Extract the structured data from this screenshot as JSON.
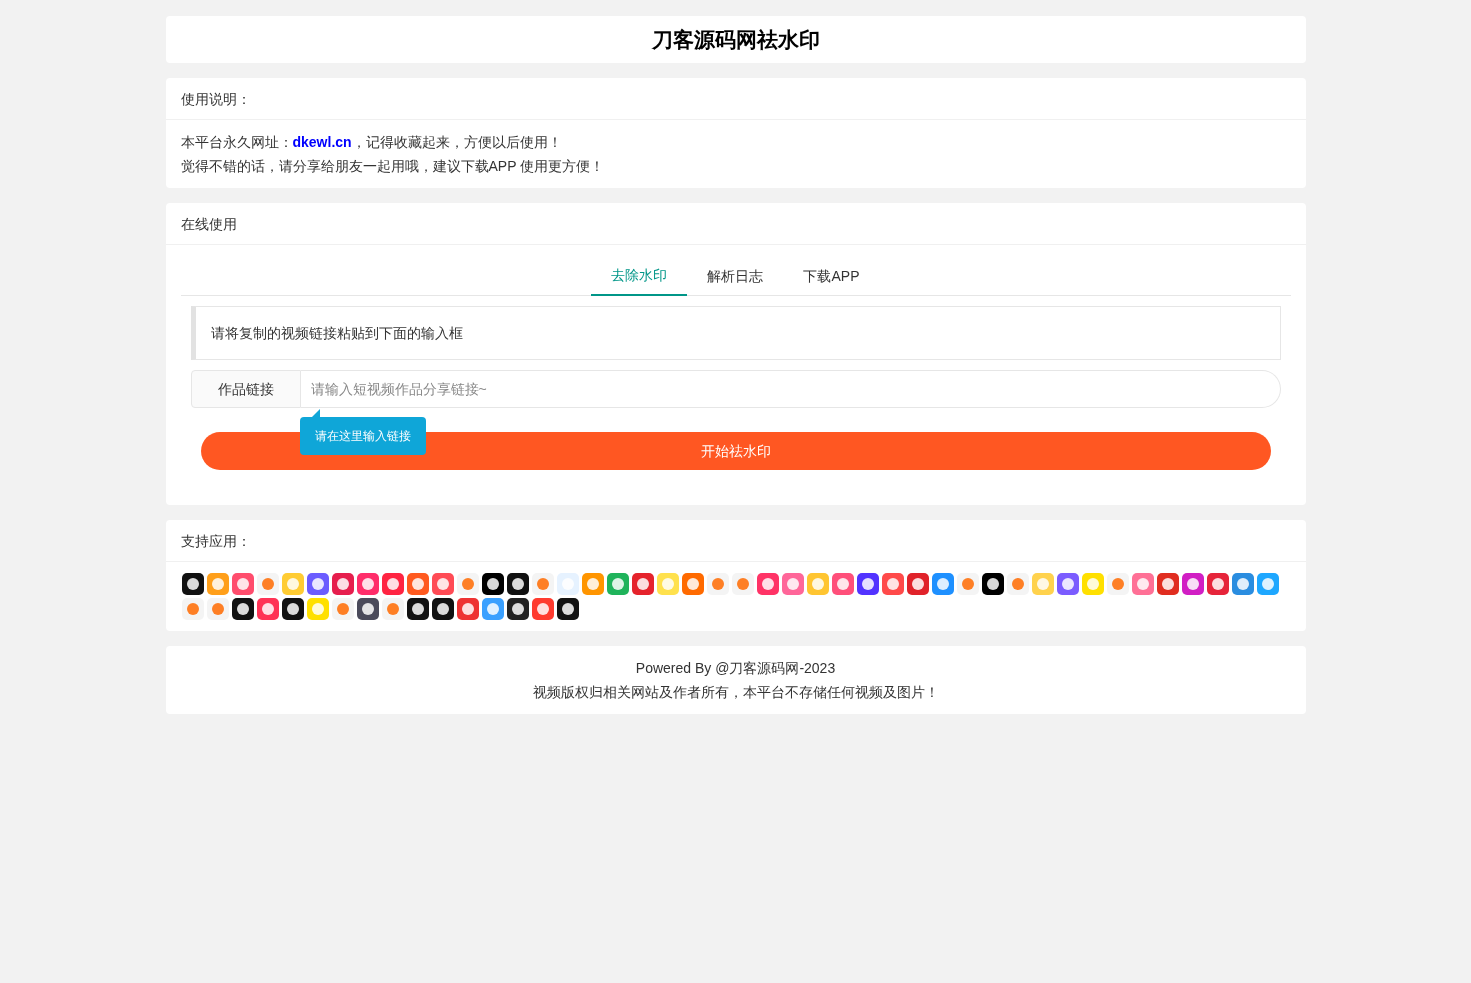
{
  "header": {
    "title": "刀客源码网祛水印"
  },
  "instructions": {
    "heading": "使用说明：",
    "lines": [
      "本平台永久网址：**dkewl.cn**，记得收藏起来，方便以后使用！",
      "觉得不错的话，请分享给朋友一起用哦，建议下载APP 使用更方便！"
    ]
  },
  "online": {
    "heading": "在线使用",
    "tabs": [
      {
        "label": "去除水印",
        "selected": true
      },
      {
        "label": "解析日志",
        "selected": false
      },
      {
        "label": "下载APP",
        "selected": false
      }
    ],
    "notice": "请将复制的视频链接粘贴到下面的输入框",
    "field": {
      "label": "作品链接",
      "placeholder": "请输入短视频作品分享链接~"
    },
    "tooltip": "请在这里输入链接",
    "button": "开始祛水印"
  },
  "apps": {
    "heading": "支持应用："
  },
  "footer": {
    "lines": [
      "Powered By @刀客源码网-2023",
      "视频版权归相关网站及作者所有，本平台不存储任何视频及图片！"
    ]
  }
}
